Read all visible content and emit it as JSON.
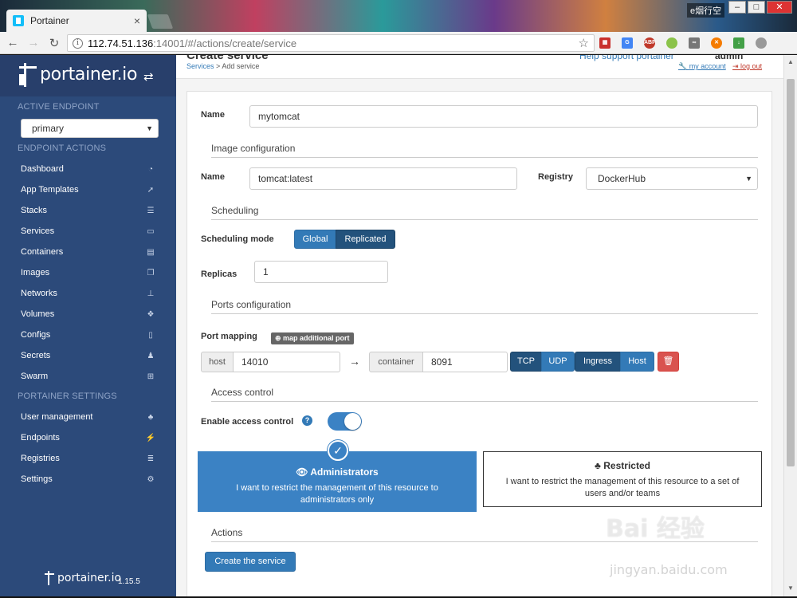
{
  "browser": {
    "tab_title": "Portainer",
    "tab_close": "×",
    "os_user": "e烟行空",
    "url_host": "112.74.51.136",
    "url_rest": ":14001/#/actions/create/service",
    "extensions": [
      "red-grid-icon",
      "translate-icon",
      "abp-icon",
      "green-circle-icon",
      "glasses-icon",
      "orange-x-icon",
      "green-download-icon",
      "globe-icon"
    ]
  },
  "sidebar": {
    "brand": "portainer.io",
    "active_endpoint_heading": "ACTIVE ENDPOINT",
    "endpoint_value": "primary",
    "endpoint_actions_heading": "ENDPOINT ACTIONS",
    "endpoint_items": [
      {
        "label": "Dashboard",
        "icon": "tachometer-icon"
      },
      {
        "label": "App Templates",
        "icon": "rocket-icon"
      },
      {
        "label": "Stacks",
        "icon": "list-icon"
      },
      {
        "label": "Services",
        "icon": "services-icon"
      },
      {
        "label": "Containers",
        "icon": "server-icon"
      },
      {
        "label": "Images",
        "icon": "clone-icon"
      },
      {
        "label": "Networks",
        "icon": "sitemap-icon"
      },
      {
        "label": "Volumes",
        "icon": "cubes-icon"
      },
      {
        "label": "Configs",
        "icon": "file-code-icon"
      },
      {
        "label": "Secrets",
        "icon": "user-secret-icon"
      },
      {
        "label": "Swarm",
        "icon": "object-group-icon"
      }
    ],
    "settings_heading": "PORTAINER SETTINGS",
    "settings_items": [
      {
        "label": "User management",
        "icon": "users-icon"
      },
      {
        "label": "Endpoints",
        "icon": "plug-icon"
      },
      {
        "label": "Registries",
        "icon": "database-icon"
      },
      {
        "label": "Settings",
        "icon": "cogs-icon"
      }
    ],
    "footer_brand": "portainer.io",
    "version": "1.15.5"
  },
  "header": {
    "page_title": "Create service",
    "breadcrumb_link": "Services",
    "breadcrumb_sep": ">",
    "breadcrumb_current": "Add service",
    "help_text": "Help support portainer",
    "user": "admin",
    "my_account": "my account",
    "log_out": "log out"
  },
  "form": {
    "name_label": "Name",
    "name_value": "mytomcat",
    "image_section": "Image configuration",
    "image_name_label": "Name",
    "image_value": "tomcat:latest",
    "registry_label": "Registry",
    "registry_value": "DockerHub",
    "scheduling_section": "Scheduling",
    "scheduling_mode_label": "Scheduling mode",
    "mode_global": "Global",
    "mode_replicated": "Replicated",
    "replicas_label": "Replicas",
    "replicas_value": "1",
    "ports_section": "Ports configuration",
    "port_mapping_label": "Port mapping",
    "map_port_button": "map additional port",
    "host_addon": "host",
    "host_value": "14010",
    "arrow": "→",
    "container_addon": "container",
    "container_value": "8091",
    "tcp": "TCP",
    "udp": "UDP",
    "ingress": "Ingress",
    "host_mode": "Host",
    "access_section": "Access control",
    "enable_access_label": "Enable access control",
    "access_enabled": true,
    "admins_title": "Administrators",
    "admins_desc": "I want to restrict the management of this resource to administrators only",
    "restricted_title": "Restricted",
    "restricted_desc": "I want to restrict the management of this resource to a set of users and/or teams",
    "actions_section": "Actions",
    "create_button": "Create the service"
  },
  "watermark": {
    "main": "Bai 经验",
    "sub": "jingyan.baidu.com"
  },
  "colors": {
    "sidebar": "#2c4a7a",
    "primary": "#337ab7",
    "danger": "#d9534f"
  }
}
